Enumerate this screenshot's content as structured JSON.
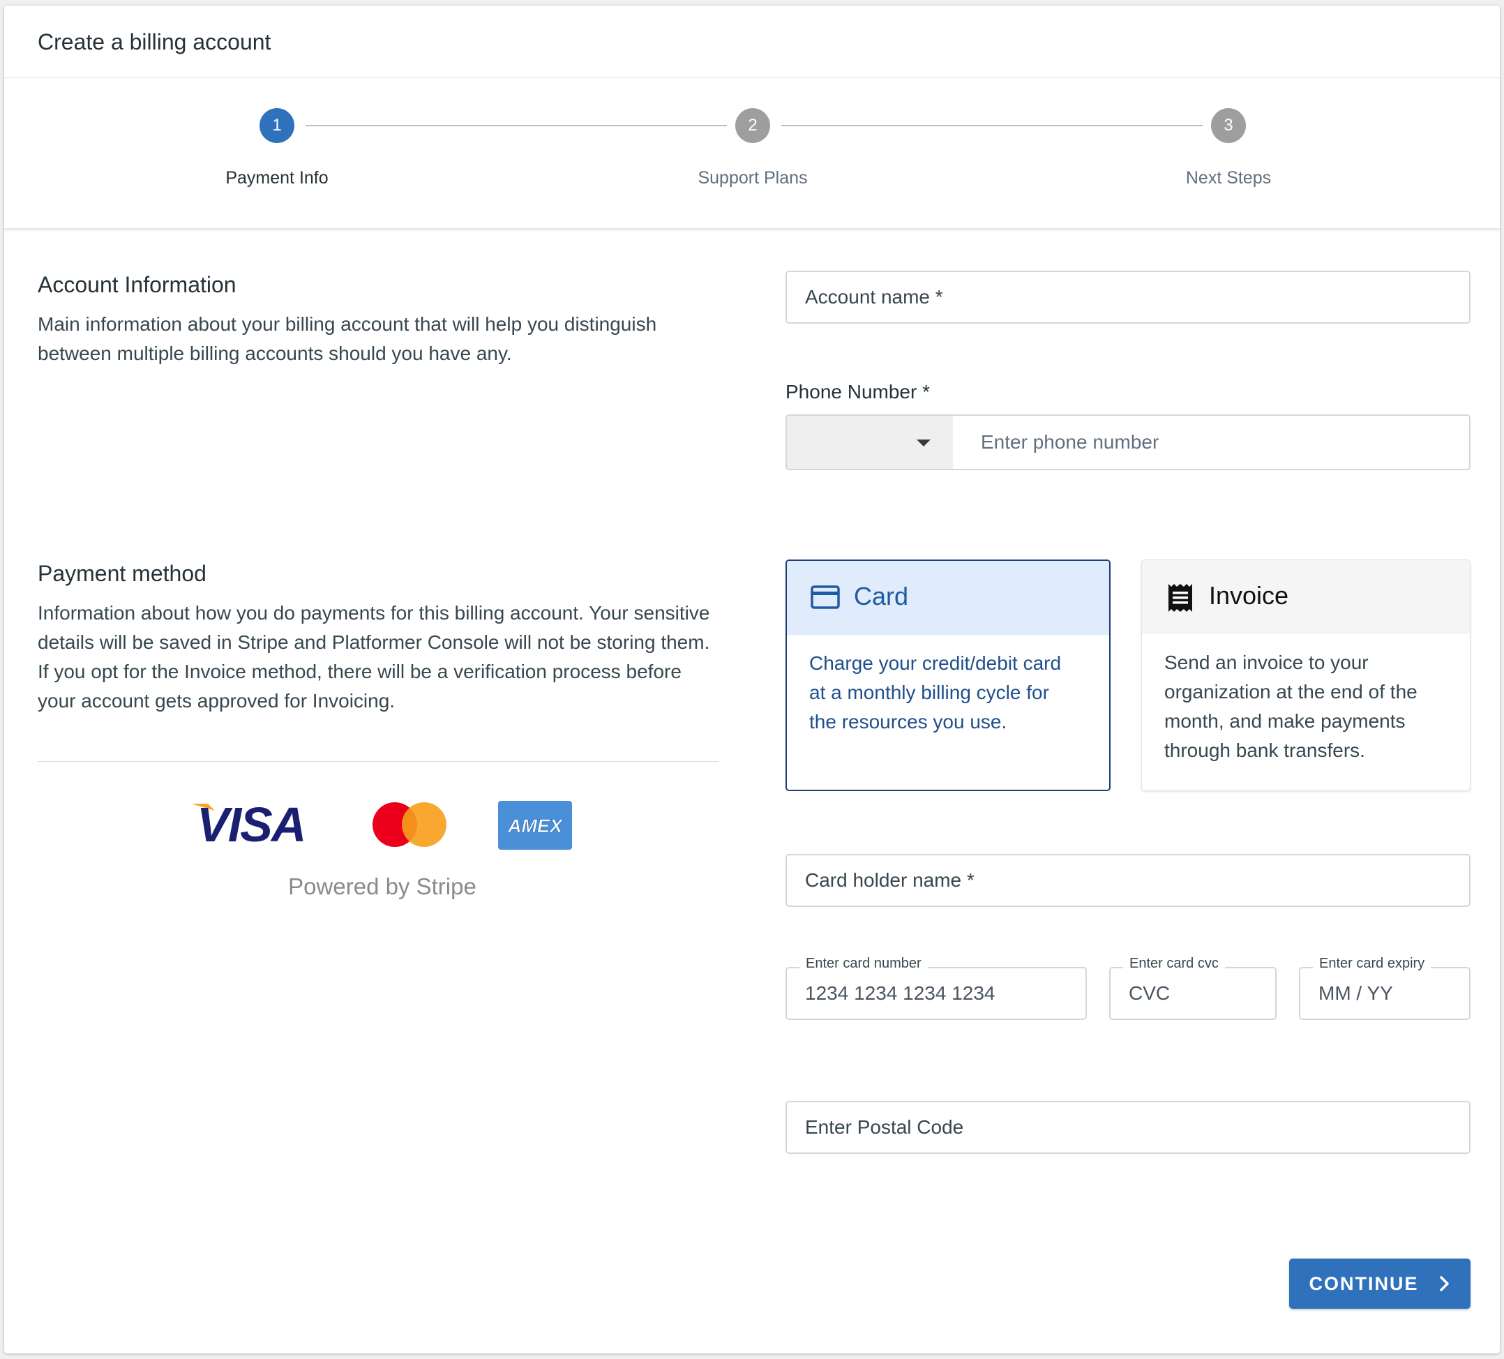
{
  "header": {
    "title": "Create a billing account"
  },
  "stepper": {
    "steps": [
      {
        "number": "1",
        "label": "Payment Info",
        "active": true
      },
      {
        "number": "2",
        "label": "Support Plans",
        "active": false
      },
      {
        "number": "3",
        "label": "Next Steps",
        "active": false
      }
    ]
  },
  "account_info": {
    "title": "Account Information",
    "description_line1": "Main information about your billing account that will help you distinguish",
    "description_line2": "between multiple billing accounts should you have any.",
    "account_name_placeholder": "Account name *",
    "phone_label": "Phone Number *",
    "phone_placeholder": "Enter phone number",
    "country_code_value": ""
  },
  "payment_method": {
    "title": "Payment method",
    "description_lines": [
      "Information about how you do payments for this billing account. Your sensitive",
      "details will be saved in Stripe and Platformer Console will not be storing them.",
      "If you opt for the Invoice method, there will be a verification process before",
      "your account gets approved for Invoicing."
    ],
    "logos": {
      "visa": "VISA",
      "mastercard": "mastercard-logo",
      "amex": "AMEX"
    },
    "powered_by": "Powered by Stripe",
    "options": {
      "card": {
        "title": "Card",
        "icon": "credit-card-icon",
        "desc_lines": [
          "Charge your credit/debit card",
          "at a monthly billing cycle for",
          "the resources you use."
        ],
        "selected": true
      },
      "invoice": {
        "title": "Invoice",
        "icon": "receipt-icon",
        "desc_lines": [
          "Send an invoice to your",
          "organization at the end of the",
          "month, and make payments",
          "through bank transfers."
        ],
        "selected": false
      }
    }
  },
  "card_form": {
    "holder_placeholder": "Card holder name *",
    "number_label": "Enter card number",
    "number_placeholder": "1234 1234 1234 1234",
    "cvc_label": "Enter card cvc",
    "cvc_placeholder": "CVC",
    "expiry_label": "Enter card expiry",
    "expiry_placeholder": "MM / YY",
    "postal_placeholder": "Enter Postal Code"
  },
  "actions": {
    "continue_label": "CONTINUE"
  },
  "colors": {
    "primary": "#2f72bb",
    "selected_border": "#1c3f75",
    "selected_bg": "#e0ecfb",
    "step_inactive": "#9e9e9e",
    "amex_blue": "#4a90d9",
    "visa_blue": "#1a1f71",
    "visa_gold": "#f7a823",
    "mc_red": "#eb001b",
    "mc_orange": "#f79e1b"
  }
}
